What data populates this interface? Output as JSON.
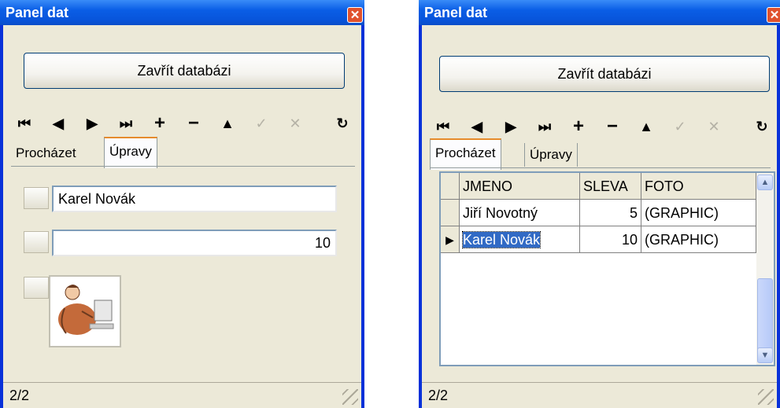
{
  "left_window": {
    "title": "Panel dat",
    "close_button": "✕",
    "close_button_label": "Zavřít databázi",
    "tabs": [
      "Procházet",
      "Úpravy"
    ],
    "active_tab": "Úpravy",
    "fields": {
      "name_value": "Karel Novák",
      "discount_value": "10"
    },
    "status": "2/2"
  },
  "right_window": {
    "title": "Panel dat",
    "close_button": "✕",
    "close_button_label": "Zavřít databázi",
    "tabs": [
      "Procházet",
      "Úpravy"
    ],
    "active_tab": "Procházet",
    "grid": {
      "columns": [
        "JMENO",
        "SLEVA",
        "FOTO"
      ],
      "rows": [
        [
          "Jiří Novotný",
          "5",
          "(GRAPHIC)"
        ],
        [
          "Karel Novák",
          "10",
          "(GRAPHIC)"
        ]
      ],
      "current_row_marker": "▶"
    },
    "status": "2/2"
  },
  "navigator": {
    "buttons": [
      {
        "name": "first-icon",
        "glyph": "⏮",
        "enabled": true
      },
      {
        "name": "prior-icon",
        "glyph": "◀",
        "enabled": true
      },
      {
        "name": "next-icon",
        "glyph": "▶",
        "enabled": true
      },
      {
        "name": "last-icon",
        "glyph": "⏭",
        "enabled": true
      },
      {
        "name": "insert-icon",
        "glyph": "+",
        "enabled": true
      },
      {
        "name": "delete-icon",
        "glyph": "−",
        "enabled": true
      },
      {
        "name": "edit-icon",
        "glyph": "▲",
        "enabled": true
      },
      {
        "name": "post-icon",
        "glyph": "✓",
        "enabled": false
      },
      {
        "name": "cancel-icon",
        "glyph": "✕",
        "enabled": false
      },
      {
        "name": "refresh-icon",
        "glyph": "↻",
        "enabled": true
      }
    ]
  },
  "colors": {
    "title_bar": "#0a5ee6",
    "window_frame": "#0831d9",
    "face": "#ece9d8",
    "selection": "#316ac5",
    "tab_highlight": "#e68b2c"
  }
}
